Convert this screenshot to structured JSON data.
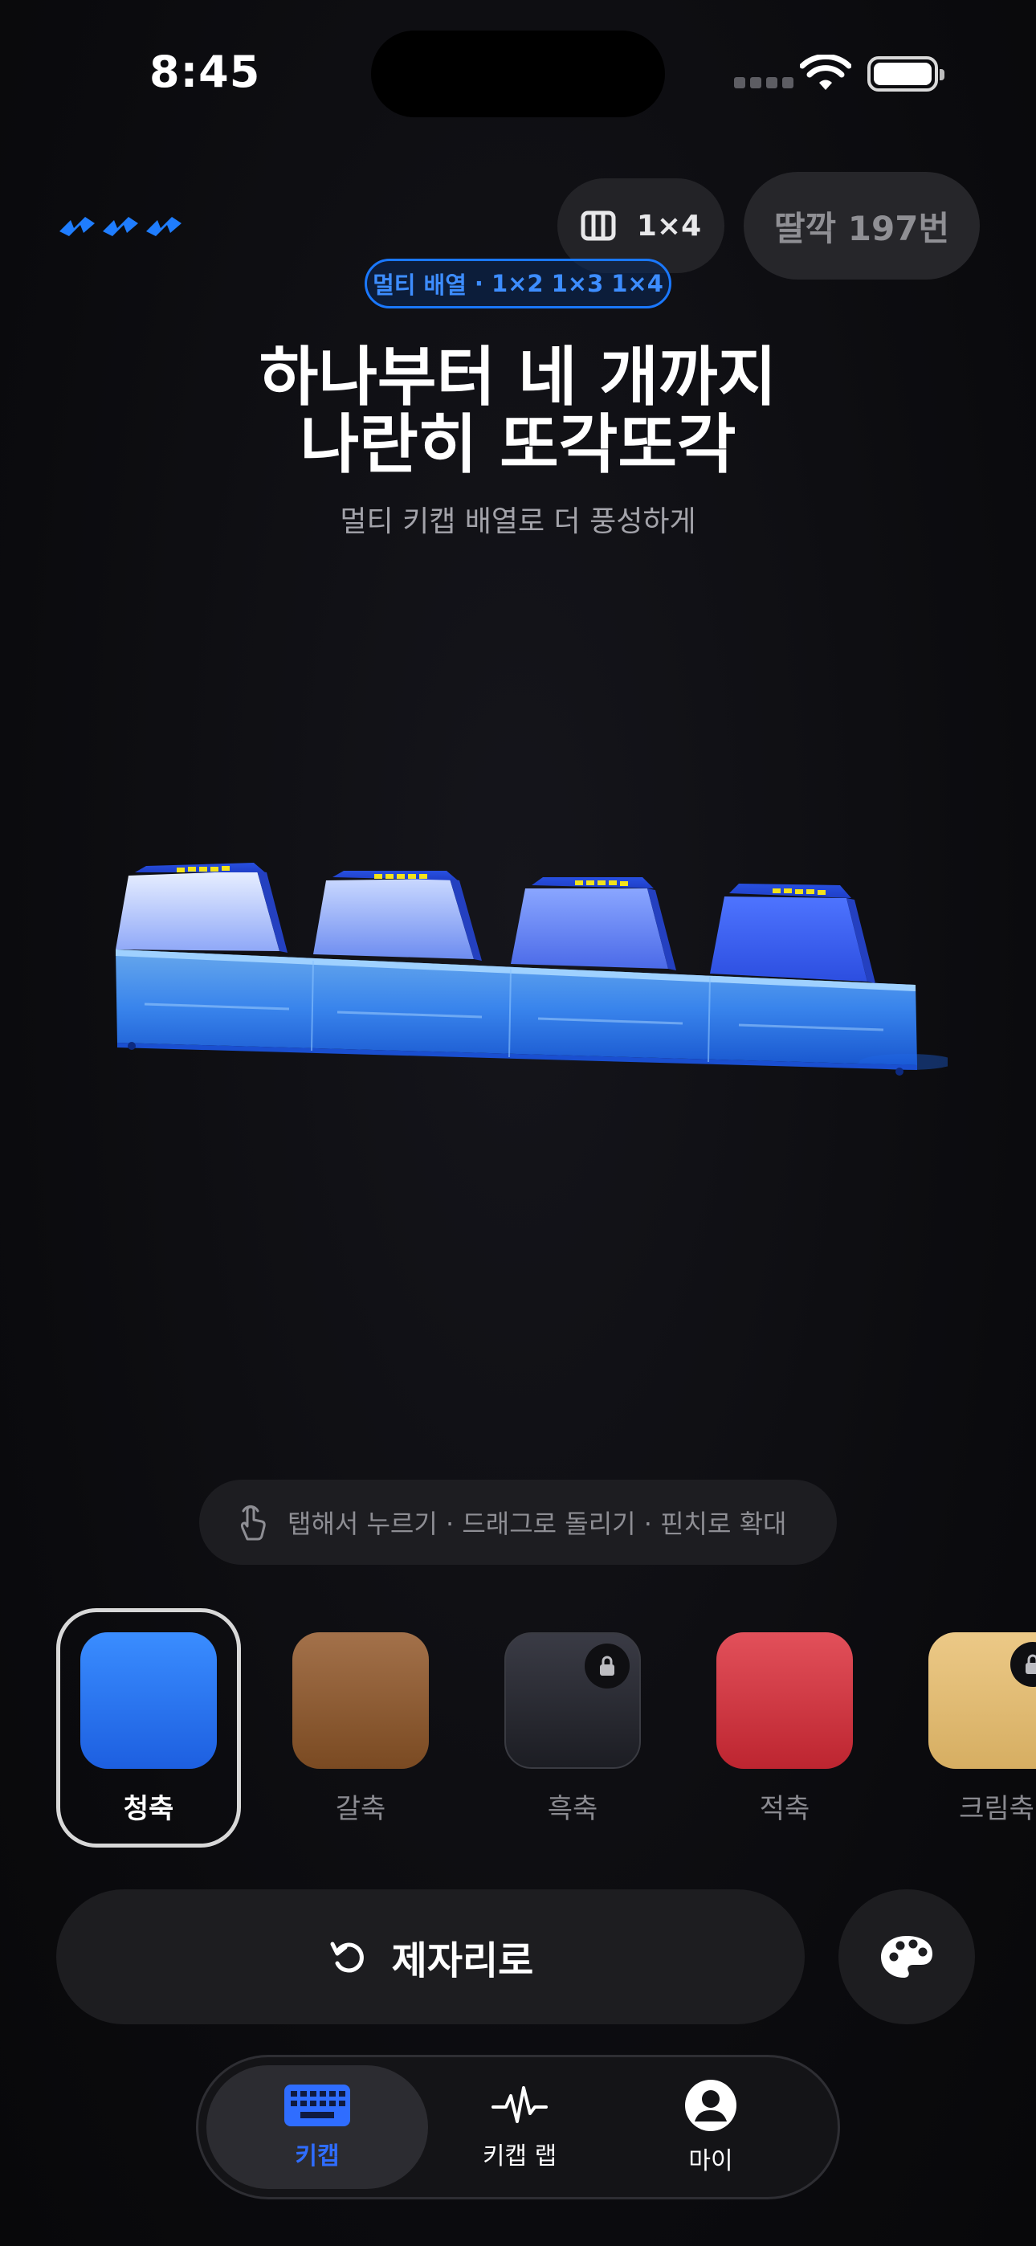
{
  "status_bar": {
    "time": "8:45"
  },
  "top_bar": {
    "layout_label": "1×4",
    "click_count": "딸깍 197번"
  },
  "badge": {
    "label": "멀티 배열",
    "separator": "·",
    "options": [
      "1×2",
      "1×3",
      "1×4"
    ]
  },
  "hero": {
    "title_line1": "하나부터 네 개까지",
    "title_line2": "나란히 또각또각",
    "subtitle": "멀티 키캡 배열로 더 풍성하게"
  },
  "hint": {
    "text": "탭해서 누르기 · 드래그로 돌리기 · 핀치로 확대"
  },
  "switches": [
    {
      "name": "청축",
      "color": "#2f7ef7",
      "selected": true,
      "locked": false
    },
    {
      "name": "갈축",
      "color": "#8c5a30",
      "selected": false,
      "locked": false
    },
    {
      "name": "흑축",
      "color": "#2a2b33",
      "selected": false,
      "locked": true
    },
    {
      "name": "적축",
      "color": "#d8373f",
      "selected": false,
      "locked": false
    },
    {
      "name": "크림축",
      "color": "#e4c07a",
      "selected": false,
      "locked": true
    }
  ],
  "actions": {
    "reset_label": "제자리로",
    "reset_icon": "rotate-ccw-icon",
    "palette_icon": "palette-icon"
  },
  "tabs": [
    {
      "label": "키캡",
      "icon": "keyboard-icon",
      "active": true
    },
    {
      "label": "키캡 랩",
      "icon": "heartbeat-icon",
      "active": false
    },
    {
      "label": "마이",
      "icon": "person-icon",
      "active": false
    }
  ],
  "colors": {
    "accent": "#2f6dff",
    "badge_blue": "#3d8dff",
    "background": "#0c0c10"
  }
}
